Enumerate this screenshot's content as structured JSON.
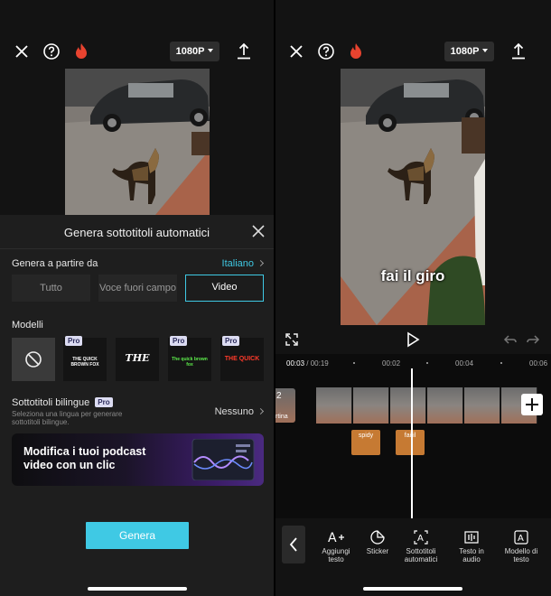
{
  "left": {
    "topbar": {
      "resolution": "1080P"
    },
    "sheet": {
      "title": "Genera sottotitoli automatici",
      "genera_da_label": "Genera a partire da",
      "language": "Italiano",
      "segments": [
        "Tutto",
        "Voce fuori campo",
        "Video"
      ],
      "selected_segment": "Video",
      "modelli_label": "Modelli",
      "models": [
        {
          "badge": "",
          "text": ""
        },
        {
          "badge": "Pro",
          "text": "THE QUICK BROWN FOX"
        },
        {
          "badge": "",
          "text": "THE"
        },
        {
          "badge": "Pro",
          "text": "The quick brown fox"
        },
        {
          "badge": "Pro",
          "text": "THE QUICK"
        }
      ],
      "bilingual_label": "Sottotitoli bilingue",
      "bilingual_badge": "Pro",
      "bilingual_desc": "Seleziona una lingua per generare sottotitoli bilingue.",
      "bilingual_value": "Nessuno",
      "banner_text": "Modifica i tuoi podcast video con un clic",
      "genera_button": "Genera"
    }
  },
  "right": {
    "topbar": {
      "resolution": "1080P"
    },
    "caption": "fai il giro",
    "time_current": "00:03",
    "time_separator": "/",
    "time_total": "00:19",
    "ruler_ticks": [
      "00:02",
      "00:04",
      "00:06"
    ],
    "cover_label": "rtina",
    "cover_number": "2",
    "clips": [
      {
        "text": "spidy"
      },
      {
        "text": "fai il"
      }
    ],
    "tools": [
      {
        "icon": "add-text-icon",
        "label": "Aggiungi testo"
      },
      {
        "icon": "sticker-icon",
        "label": "Sticker"
      },
      {
        "icon": "auto-captions-icon",
        "label": "Sottotitoli automatici"
      },
      {
        "icon": "text-to-audio-icon",
        "label": "Testo in audio"
      },
      {
        "icon": "text-template-icon",
        "label": "Modello di testo"
      }
    ]
  },
  "colors": {
    "accent": "#3fc9e4",
    "clip_orange": "#c67a33",
    "flame": "#e8432f",
    "pro_badge": "#dcdcf2"
  }
}
